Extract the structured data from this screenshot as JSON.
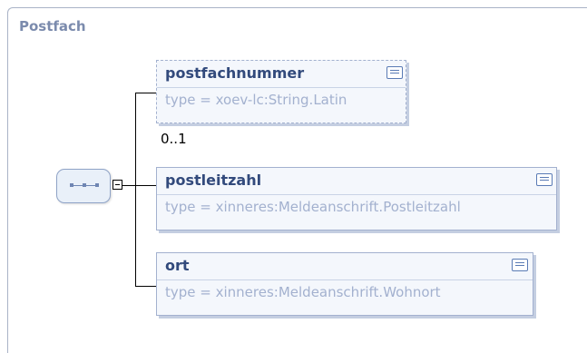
{
  "diagram": {
    "title": "Postfach",
    "elements": [
      {
        "name": "postfachnummer",
        "type": "type = xoev-lc:String.Latin",
        "occurs": "0..1"
      },
      {
        "name": "postleitzahl",
        "type": "type = xinneres:Meldeanschrift.Postleitzahl"
      },
      {
        "name": "ort",
        "type": "type = xinneres:Meldeanschrift.Wohnort"
      }
    ],
    "compositor_icon": "sequence-icon",
    "collapse_icon": "collapse-minus-icon",
    "doc_icon": "documentation-icon"
  }
}
